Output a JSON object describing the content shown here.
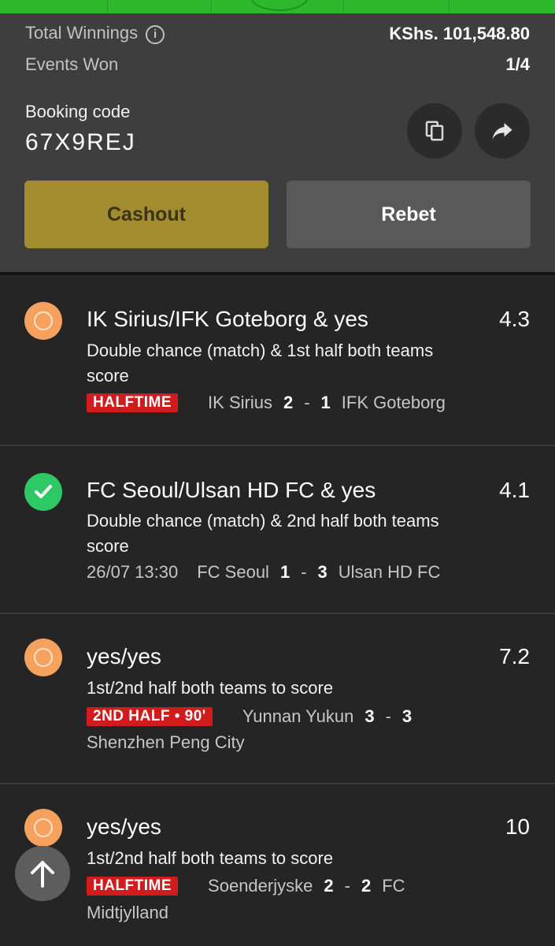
{
  "summary": {
    "total_winnings_label": "Total Winnings",
    "total_winnings_value": "KShs. 101,548.80",
    "events_won_label": "Events Won",
    "events_won_value": "1/4",
    "booking_label": "Booking code",
    "booking_code": "67X9REJ",
    "cashout_label": "Cashout",
    "rebet_label": "Rebet"
  },
  "events": [
    {
      "status": "pending",
      "title": "IK Sirius/IFK Goteborg & yes",
      "odds": "4.3",
      "market": "Double chance (match) & 1st half both teams score",
      "badge": "HALFTIME",
      "home": "IK Sirius",
      "home_score": "2",
      "away_score": "1",
      "away": "IFK Goteborg"
    },
    {
      "status": "won",
      "title": "FC Seoul/Ulsan HD FC & yes",
      "odds": "4.1",
      "market": "Double chance (match) & 2nd half both teams score",
      "time": "26/07 13:30",
      "home": "FC Seoul",
      "home_score": "1",
      "away_score": "3",
      "away": "Ulsan HD FC"
    },
    {
      "status": "pending",
      "title": "yes/yes",
      "odds": "7.2",
      "market": "1st/2nd half both teams to score",
      "badge": "2ND HALF • 90'",
      "home": "Yunnan Yukun",
      "home_score": "3",
      "away_score": "3",
      "away": "Shenzhen Peng City"
    },
    {
      "status": "pending",
      "title": "yes/yes",
      "odds": "10",
      "market": "1st/2nd half both teams to score",
      "badge": "HALFTIME",
      "home": "Soenderjyske",
      "home_score": "2",
      "away_score": "2",
      "away_part1": "FC",
      "away_part2": "Midtjylland"
    }
  ],
  "icons": {
    "info": "info-icon",
    "copy": "copy-icon",
    "share": "share-icon",
    "scroll_top": "arrow-up-icon",
    "pending": "pending-status-icon",
    "won": "check-icon"
  },
  "colors": {
    "brand_green": "#2db82d",
    "cashout": "#a38c2f",
    "live_badge": "#d01c1c",
    "won": "#2ec866",
    "pending": "#f6a25f"
  }
}
